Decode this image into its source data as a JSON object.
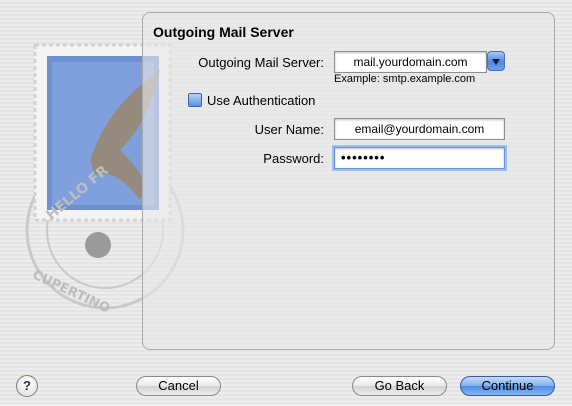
{
  "panel": {
    "title": "Outgoing Mail Server"
  },
  "server": {
    "label": "Outgoing Mail Server:",
    "value": "mail.yourdomain.com",
    "example": "Example: smtp.example.com"
  },
  "auth": {
    "checkbox_label": "Use Authentication",
    "checked": false,
    "username_label": "User Name:",
    "username_value": "email@yourdomain.com",
    "password_label": "Password:",
    "password_masked": "••••••••"
  },
  "stamp": {
    "text_top": "HELLO FR",
    "text_bottom": "CUPERTINO"
  },
  "buttons": {
    "help": "?",
    "cancel": "Cancel",
    "go_back": "Go Back",
    "continue": "Continue"
  },
  "icons": {
    "combo": "chevron-down-icon",
    "help": "question-icon"
  }
}
